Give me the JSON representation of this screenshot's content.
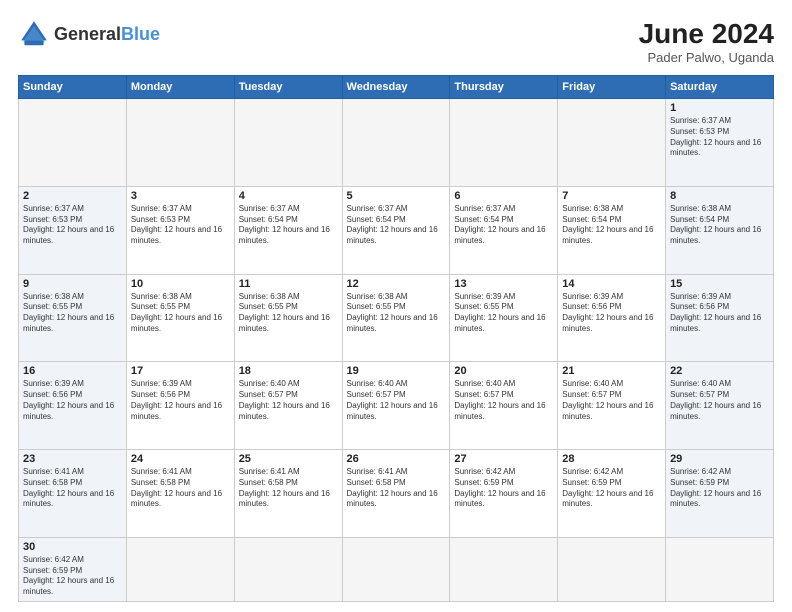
{
  "logo": {
    "text_general": "General",
    "text_blue": "Blue"
  },
  "header": {
    "month_year": "June 2024",
    "location": "Pader Palwo, Uganda"
  },
  "days_of_week": [
    "Sunday",
    "Monday",
    "Tuesday",
    "Wednesday",
    "Thursday",
    "Friday",
    "Saturday"
  ],
  "weeks": [
    [
      {
        "day": "",
        "info": ""
      },
      {
        "day": "",
        "info": ""
      },
      {
        "day": "",
        "info": ""
      },
      {
        "day": "",
        "info": ""
      },
      {
        "day": "",
        "info": ""
      },
      {
        "day": "",
        "info": ""
      },
      {
        "day": "1",
        "info": "Sunrise: 6:37 AM\nSunset: 6:53 PM\nDaylight: 12 hours and 16 minutes."
      }
    ],
    [
      {
        "day": "2",
        "info": "Sunrise: 6:37 AM\nSunset: 6:53 PM\nDaylight: 12 hours and 16 minutes."
      },
      {
        "day": "3",
        "info": "Sunrise: 6:37 AM\nSunset: 6:53 PM\nDaylight: 12 hours and 16 minutes."
      },
      {
        "day": "4",
        "info": "Sunrise: 6:37 AM\nSunset: 6:54 PM\nDaylight: 12 hours and 16 minutes."
      },
      {
        "day": "5",
        "info": "Sunrise: 6:37 AM\nSunset: 6:54 PM\nDaylight: 12 hours and 16 minutes."
      },
      {
        "day": "6",
        "info": "Sunrise: 6:37 AM\nSunset: 6:54 PM\nDaylight: 12 hours and 16 minutes."
      },
      {
        "day": "7",
        "info": "Sunrise: 6:38 AM\nSunset: 6:54 PM\nDaylight: 12 hours and 16 minutes."
      },
      {
        "day": "8",
        "info": "Sunrise: 6:38 AM\nSunset: 6:54 PM\nDaylight: 12 hours and 16 minutes."
      }
    ],
    [
      {
        "day": "9",
        "info": "Sunrise: 6:38 AM\nSunset: 6:55 PM\nDaylight: 12 hours and 16 minutes."
      },
      {
        "day": "10",
        "info": "Sunrise: 6:38 AM\nSunset: 6:55 PM\nDaylight: 12 hours and 16 minutes."
      },
      {
        "day": "11",
        "info": "Sunrise: 6:38 AM\nSunset: 6:55 PM\nDaylight: 12 hours and 16 minutes."
      },
      {
        "day": "12",
        "info": "Sunrise: 6:38 AM\nSunset: 6:55 PM\nDaylight: 12 hours and 16 minutes."
      },
      {
        "day": "13",
        "info": "Sunrise: 6:39 AM\nSunset: 6:55 PM\nDaylight: 12 hours and 16 minutes."
      },
      {
        "day": "14",
        "info": "Sunrise: 6:39 AM\nSunset: 6:56 PM\nDaylight: 12 hours and 16 minutes."
      },
      {
        "day": "15",
        "info": "Sunrise: 6:39 AM\nSunset: 6:56 PM\nDaylight: 12 hours and 16 minutes."
      }
    ],
    [
      {
        "day": "16",
        "info": "Sunrise: 6:39 AM\nSunset: 6:56 PM\nDaylight: 12 hours and 16 minutes."
      },
      {
        "day": "17",
        "info": "Sunrise: 6:39 AM\nSunset: 6:56 PM\nDaylight: 12 hours and 16 minutes."
      },
      {
        "day": "18",
        "info": "Sunrise: 6:40 AM\nSunset: 6:57 PM\nDaylight: 12 hours and 16 minutes."
      },
      {
        "day": "19",
        "info": "Sunrise: 6:40 AM\nSunset: 6:57 PM\nDaylight: 12 hours and 16 minutes."
      },
      {
        "day": "20",
        "info": "Sunrise: 6:40 AM\nSunset: 6:57 PM\nDaylight: 12 hours and 16 minutes."
      },
      {
        "day": "21",
        "info": "Sunrise: 6:40 AM\nSunset: 6:57 PM\nDaylight: 12 hours and 16 minutes."
      },
      {
        "day": "22",
        "info": "Sunrise: 6:40 AM\nSunset: 6:57 PM\nDaylight: 12 hours and 16 minutes."
      }
    ],
    [
      {
        "day": "23",
        "info": "Sunrise: 6:41 AM\nSunset: 6:58 PM\nDaylight: 12 hours and 16 minutes."
      },
      {
        "day": "24",
        "info": "Sunrise: 6:41 AM\nSunset: 6:58 PM\nDaylight: 12 hours and 16 minutes."
      },
      {
        "day": "25",
        "info": "Sunrise: 6:41 AM\nSunset: 6:58 PM\nDaylight: 12 hours and 16 minutes."
      },
      {
        "day": "26",
        "info": "Sunrise: 6:41 AM\nSunset: 6:58 PM\nDaylight: 12 hours and 16 minutes."
      },
      {
        "day": "27",
        "info": "Sunrise: 6:42 AM\nSunset: 6:59 PM\nDaylight: 12 hours and 16 minutes."
      },
      {
        "day": "28",
        "info": "Sunrise: 6:42 AM\nSunset: 6:59 PM\nDaylight: 12 hours and 16 minutes."
      },
      {
        "day": "29",
        "info": "Sunrise: 6:42 AM\nSunset: 6:59 PM\nDaylight: 12 hours and 16 minutes."
      }
    ],
    [
      {
        "day": "30",
        "info": "Sunrise: 6:42 AM\nSunset: 6:59 PM\nDaylight: 12 hours and 16 minutes."
      },
      {
        "day": "",
        "info": ""
      },
      {
        "day": "",
        "info": ""
      },
      {
        "day": "",
        "info": ""
      },
      {
        "day": "",
        "info": ""
      },
      {
        "day": "",
        "info": ""
      },
      {
        "day": "",
        "info": ""
      }
    ]
  ]
}
